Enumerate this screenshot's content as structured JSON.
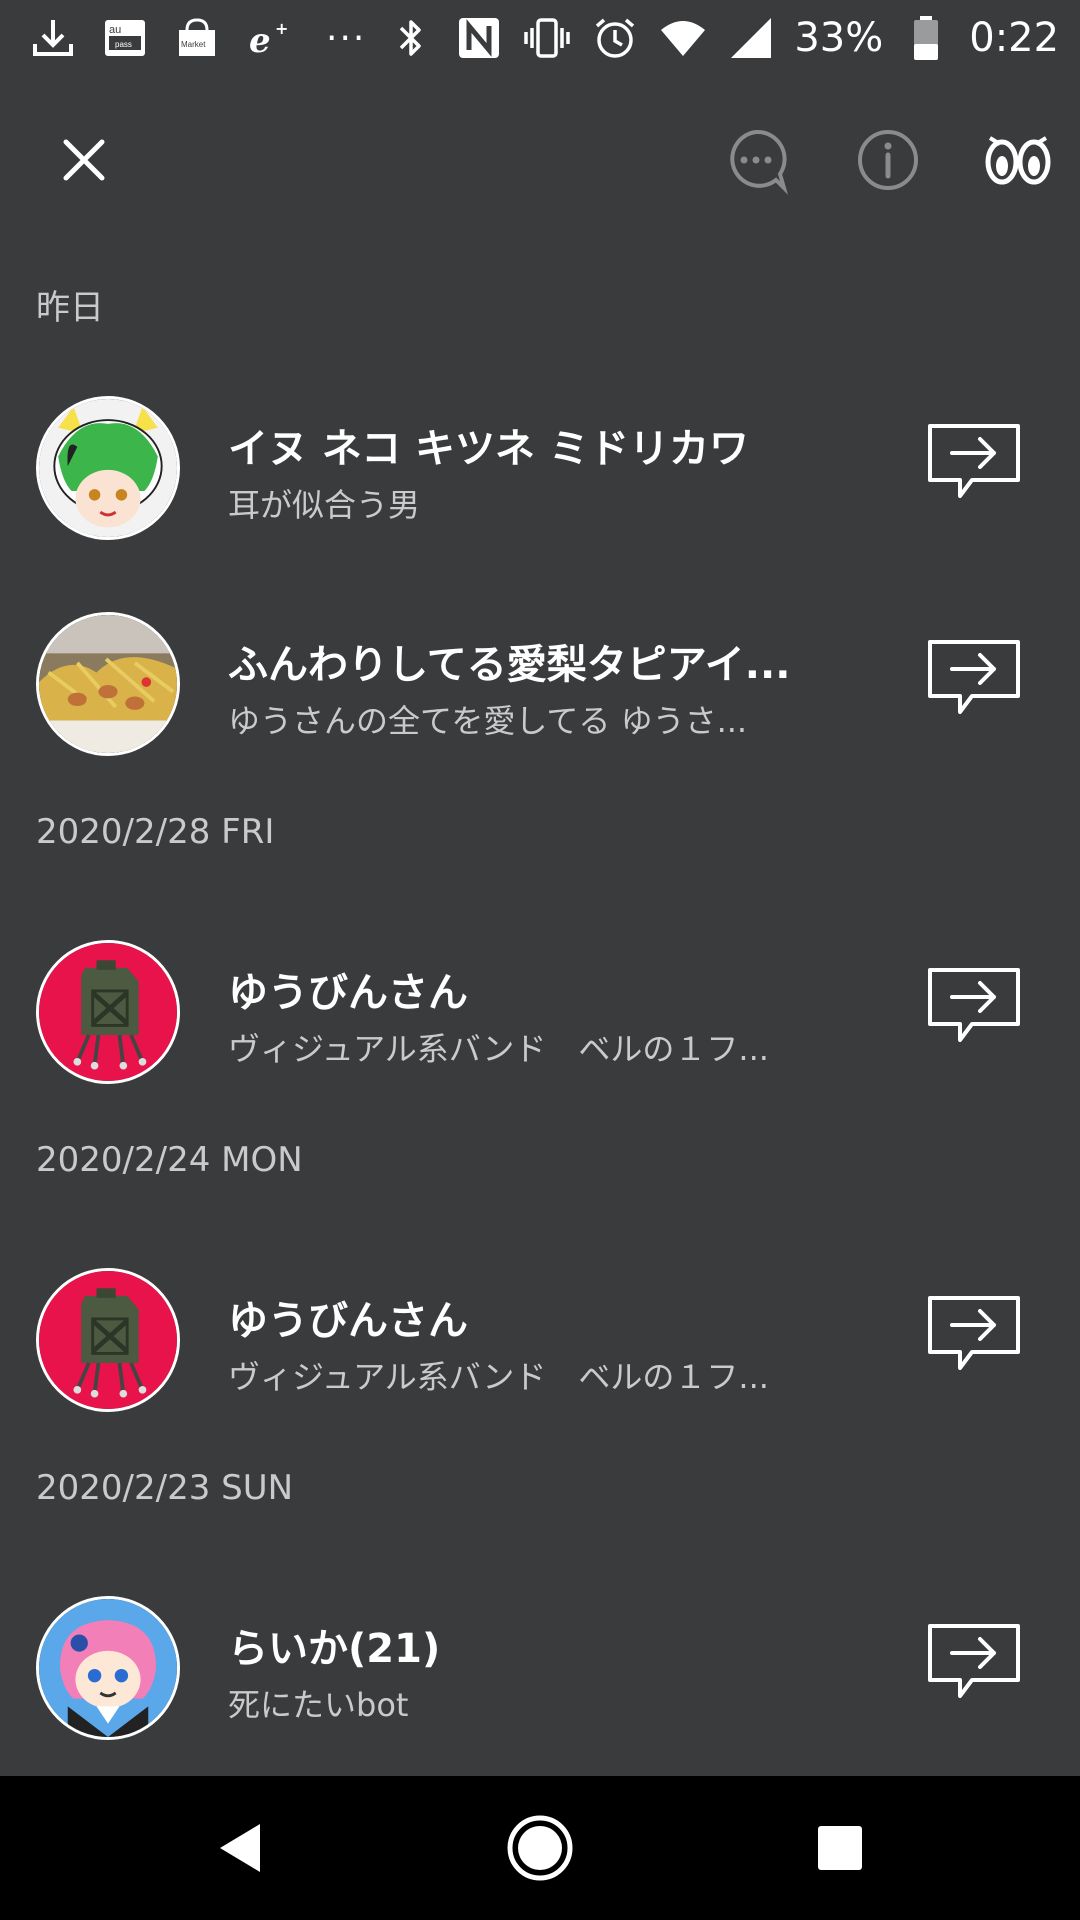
{
  "status_bar": {
    "icons_left": [
      "download-icon",
      "au-pass-icon",
      "market-icon",
      "e-plus-icon",
      "more-dots-icon"
    ],
    "overflow": "···",
    "icons_right": [
      "bluetooth-icon",
      "nfc-icon",
      "vibrate-icon",
      "alarm-icon",
      "wifi-icon",
      "signal-icon",
      "battery-icon"
    ],
    "battery": "33%",
    "time": "0:22",
    "badge_au": "au",
    "badge_pass": "pass",
    "badge_market": "Market"
  },
  "top_bar": {
    "icons": [
      "close-icon",
      "chat-icon",
      "info-icon",
      "eyes-icon"
    ]
  },
  "sections": [
    {
      "header": "昨日",
      "friends": [
        {
          "name": "イヌ ネコ キツネ ミドリカワ",
          "status": "耳が似合う男"
        },
        {
          "name": "ふんわりしてる愛梨タピアイ...",
          "status": "ゆうさんの全てを愛してる ゆうさ..."
        }
      ]
    },
    {
      "header": "2020/2/28 FRI",
      "friends": [
        {
          "name": "ゆうびんさん",
          "status": "ヴィジュアル系バンド　ベルの１フ..."
        }
      ]
    },
    {
      "header": "2020/2/24 MON",
      "friends": [
        {
          "name": "ゆうびんさん",
          "status": "ヴィジュアル系バンド　ベルの１フ..."
        }
      ]
    },
    {
      "header": "2020/2/23 SUN",
      "friends": [
        {
          "name": "らいか(21)",
          "status": "死にたいbot"
        }
      ]
    }
  ],
  "colors": {
    "background": "#3a3b3d",
    "text_primary": "#ffffff",
    "text_secondary": "#c9cacc",
    "nav_background": "#000000",
    "avatar_red": "#e8134a",
    "avatar_blue": "#5aa8ea"
  },
  "nav_bar": {
    "icons": [
      "back-icon",
      "home-icon",
      "recent-apps-icon"
    ]
  }
}
